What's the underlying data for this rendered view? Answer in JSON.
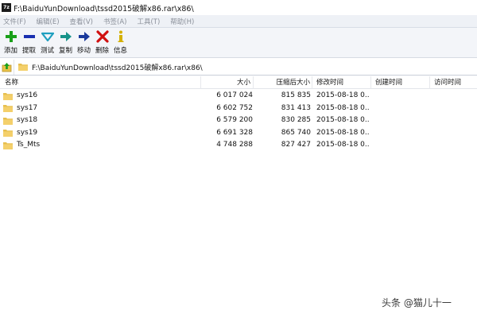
{
  "window": {
    "logo_text": "7z",
    "title": "F:\\BaiduYunDownload\\tssd2015破解x86.rar\\x86\\"
  },
  "menu": [
    "文件(F)",
    "编辑(E)",
    "查看(V)",
    "书签(A)",
    "工具(T)",
    "帮助(H)"
  ],
  "toolbar": [
    {
      "label": "添加",
      "icon": "add-icon",
      "color": "#1aa01a"
    },
    {
      "label": "提取",
      "icon": "extract-icon",
      "color": "#1a2fb0"
    },
    {
      "label": "测试",
      "icon": "test-icon",
      "color": "#1f9fbf"
    },
    {
      "label": "复制",
      "icon": "copy-icon",
      "color": "#17938a"
    },
    {
      "label": "移动",
      "icon": "move-icon",
      "color": "#1b3a9c"
    },
    {
      "label": "删除",
      "icon": "delete-icon",
      "color": "#d01010"
    },
    {
      "label": "信息",
      "icon": "info-icon",
      "color": "#d4b000"
    }
  ],
  "address": {
    "path": "F:\\BaiduYunDownload\\tssd2015破解x86.rar\\x86\\"
  },
  "columns": {
    "name": "名称",
    "size": "大小",
    "packed": "压缩后大小",
    "modified": "修改时间",
    "created": "创建时间",
    "accessed": "访问时间"
  },
  "files": [
    {
      "name": "sys16",
      "size": "6 017 024",
      "packed": "815 835",
      "modified": "2015-08-18 0..."
    },
    {
      "name": "sys17",
      "size": "6 602 752",
      "packed": "831 413",
      "modified": "2015-08-18 0..."
    },
    {
      "name": "sys18",
      "size": "6 579 200",
      "packed": "830 285",
      "modified": "2015-08-18 0..."
    },
    {
      "name": "sys19",
      "size": "6 691 328",
      "packed": "865 740",
      "modified": "2015-08-18 0..."
    },
    {
      "name": "Ts_Mts",
      "size": "4 748 288",
      "packed": "827 427",
      "modified": "2015-08-18 0..."
    }
  ],
  "watermark": "头条 @猫儿十一"
}
